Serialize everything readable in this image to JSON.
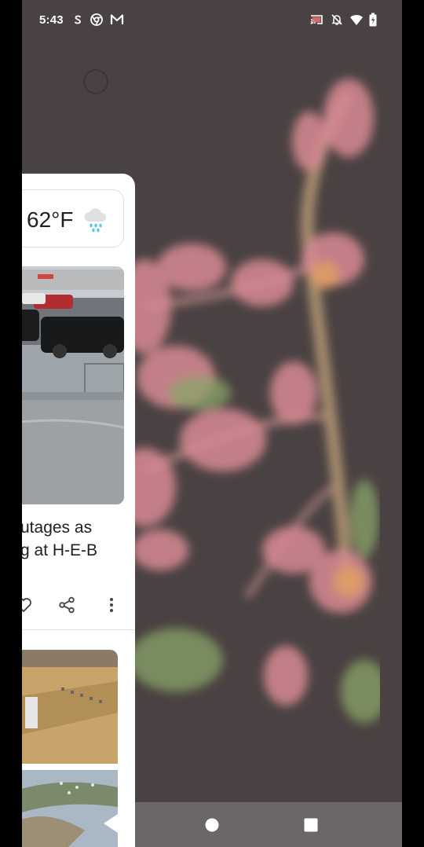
{
  "status_bar": {
    "time": "5:43",
    "left_icons": [
      "skype-icon",
      "chrome-icon",
      "gmail-icon"
    ],
    "right_icons": [
      "cast-icon",
      "notifications-off-icon",
      "wifi-icon",
      "battery-charging-icon"
    ]
  },
  "feed": {
    "weather": {
      "temperature": "62°F",
      "icon": "rain-cloud-icon"
    },
    "news": {
      "headline_line1": "utages as",
      "headline_line2": "g at H-E-B",
      "actions": [
        "like-icon",
        "share-icon",
        "more-options-icon"
      ]
    }
  },
  "nav_bar": {
    "buttons": [
      "back-button",
      "home-button",
      "recents-button"
    ]
  },
  "colors": {
    "wallpaper_bg": "#4a4242",
    "accent_pink": "#d88a93",
    "rain": "#4fc3f7"
  }
}
